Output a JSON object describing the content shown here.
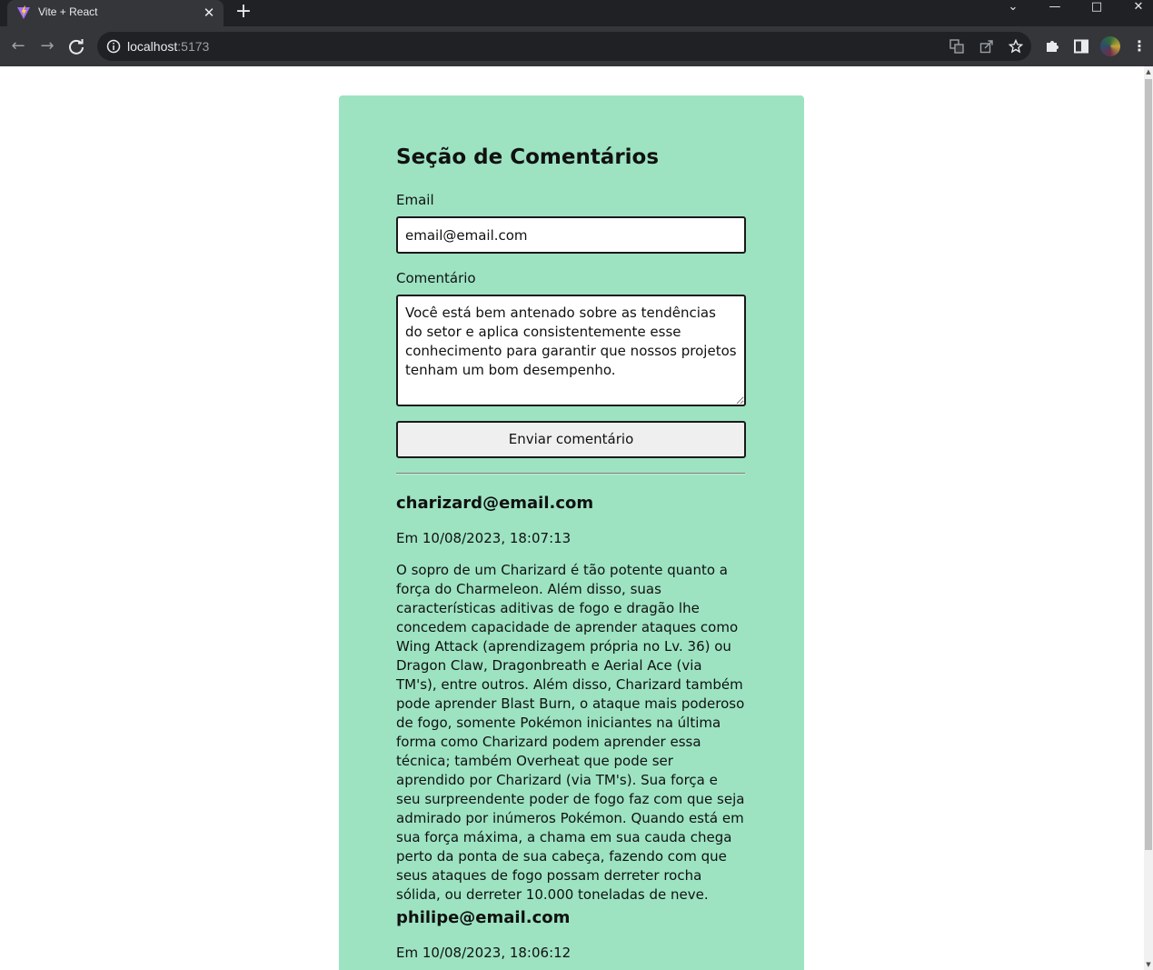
{
  "browser": {
    "tab_title": "Vite + React",
    "url_host": "localhost",
    "url_port": ":5173"
  },
  "form": {
    "title": "Seção de Comentários",
    "email_label": "Email",
    "email_value": "email@email.com",
    "comment_label": "Comentário",
    "comment_value": "Você está bem antenado sobre as tendências do setor e aplica consistentemente esse conhecimento para garantir que nossos projetos tenham um bom desempenho.",
    "submit_label": "Enviar comentário"
  },
  "comments": [
    {
      "author": "charizard@email.com",
      "date": "Em 10/08/2023, 18:07:13",
      "text": "O sopro de um Charizard é tão potente quanto a força do Charmeleon. Além disso, suas características aditivas de fogo e dragão lhe concedem capacidade de aprender ataques como Wing Attack (aprendizagem própria no Lv. 36) ou Dragon Claw, Dragonbreath e Aerial Ace (via TM's), entre outros. Além disso, Charizard também pode aprender Blast Burn, o ataque mais poderoso de fogo, somente Pokémon iniciantes na última forma como Charizard podem aprender essa técnica; também Overheat que pode ser aprendido por Charizard (via TM's). Sua força e seu surpreendente poder de fogo faz com que seja admirado por inúmeros Pokémon. Quando está em sua força máxima, a chama em sua cauda chega perto da ponta de sua cabeça, fazendo com que seus ataques de fogo possam derreter rocha sólida, ou derreter 10.000 toneladas de neve."
    },
    {
      "author": "philipe@email.com",
      "date": "Em 10/08/2023, 18:06:12",
      "text": ""
    }
  ],
  "colors": {
    "card_background": "#9de3c2",
    "chrome_dark": "#202124",
    "chrome_toolbar": "#35363a"
  }
}
